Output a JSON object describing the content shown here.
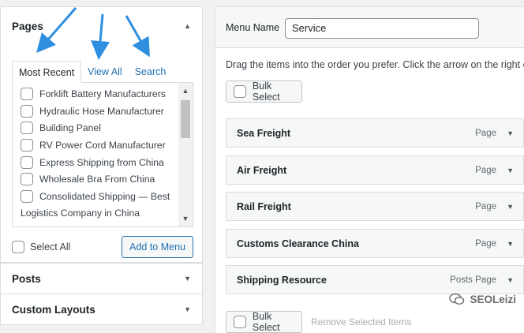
{
  "left": {
    "pages_panel": {
      "title": "Pages",
      "tabs": [
        "Most Recent",
        "View All",
        "Search"
      ],
      "items": [
        "Forklift Battery Manufacturers",
        "Hydraulic Hose Manufacturer",
        "Building Panel",
        "RV Power Cord Manufacturer",
        "Express Shipping from China",
        "Wholesale Bra From China",
        "Consolidated Shipping — Best"
      ],
      "item_wrap_tail": "Logistics Company in China",
      "select_all": "Select All",
      "add_to_menu": "Add to Menu"
    },
    "posts_panel": {
      "title": "Posts"
    },
    "layouts_panel": {
      "title": "Custom Layouts"
    }
  },
  "right": {
    "menu_name_label": "Menu Name",
    "menu_name_value": "Service",
    "instructions": "Drag the items into the order you prefer. Click the arrow on the right of t",
    "bulk_select": "Bulk Select",
    "menu_items": [
      {
        "title": "Sea Freight",
        "type": "Page"
      },
      {
        "title": "Air Freight",
        "type": "Page"
      },
      {
        "title": "Rail Freight",
        "type": "Page"
      },
      {
        "title": "Customs Clearance China",
        "type": "Page"
      },
      {
        "title": "Shipping Resource",
        "type": "Posts Page"
      }
    ],
    "bottom_bulk_select": "Bulk Select",
    "remove_selected": "Remove Selected Items"
  },
  "watermark": "SEOLeizi",
  "icons": {
    "toggle_up": "triangle-up-icon",
    "toggle_down": "triangle-down-icon",
    "annotation": "arrow-icon"
  },
  "colors": {
    "link": "#2271b1",
    "annotation_arrow": "#2e8fe0",
    "panel_border": "#dcdcde"
  }
}
